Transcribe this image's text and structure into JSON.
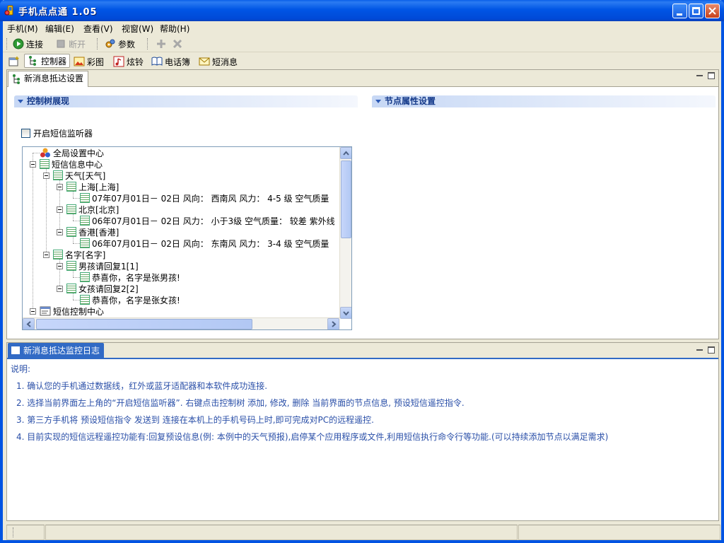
{
  "window": {
    "title": "手机点点通  1.05"
  },
  "menu": [
    {
      "label": "手机(M)"
    },
    {
      "label": "编辑(E)"
    },
    {
      "label": "查看(V)"
    },
    {
      "label": "视窗(W)"
    },
    {
      "label": "帮助(H)"
    }
  ],
  "toolbar": {
    "connect": "连接",
    "disconnect": "断开",
    "params": "参数"
  },
  "nav": {
    "controller": "控制器",
    "color_image": "彩图",
    "ringtone": "炫铃",
    "phonebook": "电话簿",
    "sms": "短消息"
  },
  "top_panel": {
    "tab": "新消息抵达设置",
    "left_section": "控制树展现",
    "right_section": "节点属性设置",
    "checkbox_label": "开启短信监听器",
    "checkbox_checked": false
  },
  "tree": {
    "n1": "全局设置中心",
    "n2": "短信信息中心",
    "n3": "天气[天气]",
    "n4": "上海[上海]",
    "n5": "07年07月01日－ 02日 风向： 西南风  风力： 4-5 级  空气质量",
    "n6": "北京[北京]",
    "n7": "06年07月01日－ 02日 风力： 小于3级  空气质量： 较差  紫外线",
    "n8": "香港[香港]",
    "n9": "06年07月01日－ 02日 风向： 东南风  风力： 3-4 级  空气质量",
    "n10": "名字[名字]",
    "n11": "男孩请回复1[1]",
    "n12": "恭喜你，名字是张男孩!",
    "n13": "女孩请回复2[2]",
    "n14": "恭喜你，名字是张女孩!",
    "n15": "短信控制中心"
  },
  "bottom_panel": {
    "tab": "新消息抵达监控日志",
    "heading": "说明:",
    "lines": {
      "l1": "1.  确认您的手机通过数据线，红外或蓝牙适配器和本软件成功连接.",
      "l2": "2.  选择当前界面左上角的“开启短信监听器”.  右键点击控制树 添加,  修改,  删除 当前界面的节点信息,  预设短信遥控指令.",
      "l3": "3.  第三方手机将 预设短信指令 发送到 连接在本机上的手机号码上时,即可完成对PC的远程遥控.",
      "l4": "4.  目前实现的短信远程遥控功能有:回复预设信息(例: 本例中的天气预报),启停某个应用程序或文件,利用短信执行命令行等功能.(可以持续添加节点以满足需求)"
    }
  },
  "colors": {
    "title_bar": "#0055e5",
    "log_text": "#2a4fa8",
    "section_text": "#153a8a",
    "log_tab": "#316ac5"
  }
}
